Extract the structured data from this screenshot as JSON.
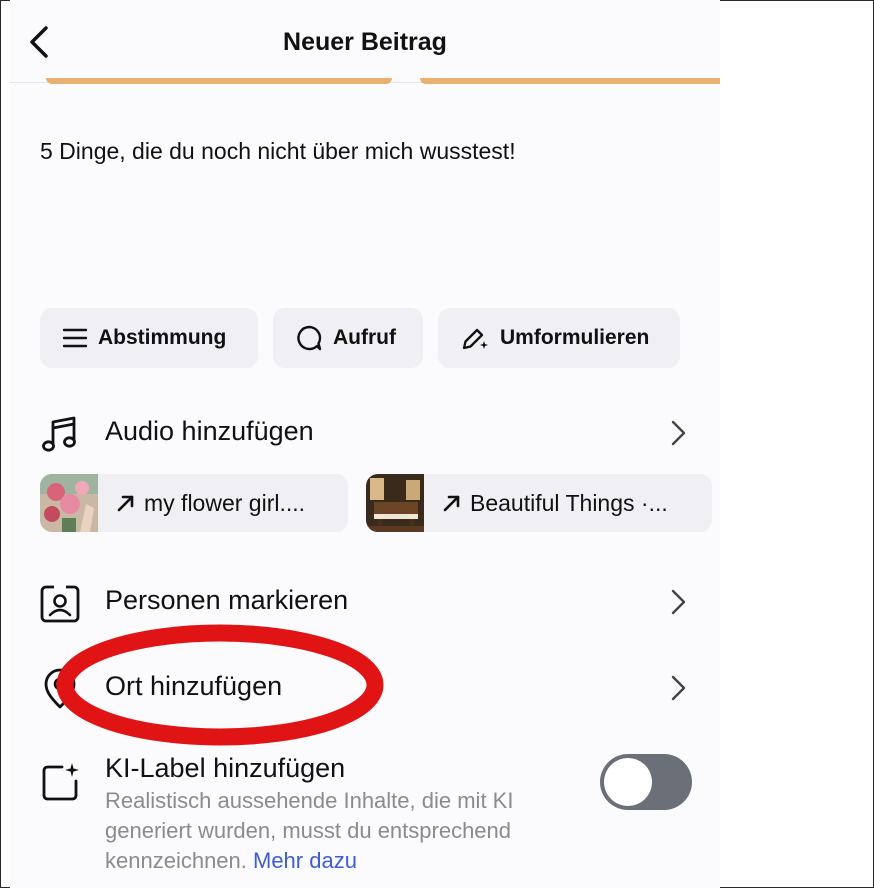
{
  "header": {
    "title": "Neuer Beitrag",
    "back_icon": "chevron-left-icon"
  },
  "caption": "5 Dinge, die du noch nicht über mich wusstest!",
  "chips": [
    {
      "label": "Abstimmung",
      "icon": "list-icon"
    },
    {
      "label": "Aufruf",
      "icon": "speech-bubble-icon"
    },
    {
      "label": "Umformulieren",
      "icon": "pen-sparkle-icon"
    }
  ],
  "audio": {
    "label": "Audio hinzufügen",
    "suggestions": [
      {
        "label": "my flower girl...."
      },
      {
        "label": "Beautiful Things ·..."
      }
    ]
  },
  "people": {
    "label": "Personen markieren"
  },
  "location": {
    "label": "Ort hinzufügen"
  },
  "ki": {
    "label": "KI-Label hinzufügen",
    "description": "Realistisch aussehende Inhalte, die mit KI generiert wurden, musst du entsprechend kennzeichnen. ",
    "link": "Mehr dazu",
    "toggle_on": false
  },
  "colors": {
    "annotation": "#e01414",
    "link": "#3e5cd8",
    "toggle_off": "#6b6f78",
    "media_accent": "#e8b071"
  }
}
